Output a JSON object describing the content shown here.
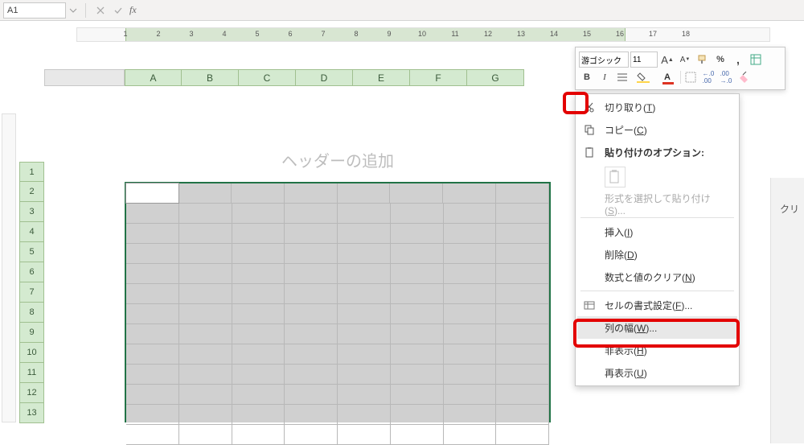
{
  "formula_bar": {
    "cell_ref": "A1",
    "fx_label": "fx"
  },
  "ruler_numbers": [
    "1",
    "2",
    "3",
    "4",
    "5",
    "6",
    "7",
    "8",
    "9",
    "10",
    "11",
    "12",
    "13",
    "14",
    "15",
    "16",
    "17",
    "18"
  ],
  "columns": [
    "A",
    "B",
    "C",
    "D",
    "E",
    "F",
    "G"
  ],
  "rows": [
    "1",
    "2",
    "3",
    "4",
    "5",
    "6",
    "7",
    "8",
    "9",
    "10",
    "11",
    "12",
    "13"
  ],
  "page_header_placeholder": "ヘッダーの追加",
  "mini_toolbar": {
    "font_name": "游ゴシック",
    "font_size": "11",
    "buttons": {
      "increase_font": "A",
      "decrease_font": "A",
      "format_painter": "⎘",
      "percent": "%",
      "comma": ",",
      "format_cells": "⊞",
      "bold": "B",
      "italic": "I",
      "align": "≡",
      "fill_color": "◆",
      "font_color": "A",
      "border": "⊞",
      "increase_decimal": ".0",
      "decrease_decimal": ".00",
      "clear": "◇"
    }
  },
  "context_menu": {
    "cut": "切り取り",
    "cut_key": "T",
    "copy": "コピー",
    "copy_key": "C",
    "paste_options": "貼り付けのオプション:",
    "paste_special": "形式を選択して貼り付け",
    "paste_special_key": "S",
    "insert": "挿入",
    "insert_key": "I",
    "delete": "削除",
    "delete_key": "D",
    "clear": "数式と値のクリア",
    "clear_key": "N",
    "format_cells": "セルの書式設定",
    "format_cells_key": "F",
    "column_width": "列の幅",
    "column_width_key": "W",
    "hide": "非表示",
    "hide_key": "H",
    "unhide": "再表示",
    "unhide_key": "U"
  },
  "right_panel_label": "クリ"
}
